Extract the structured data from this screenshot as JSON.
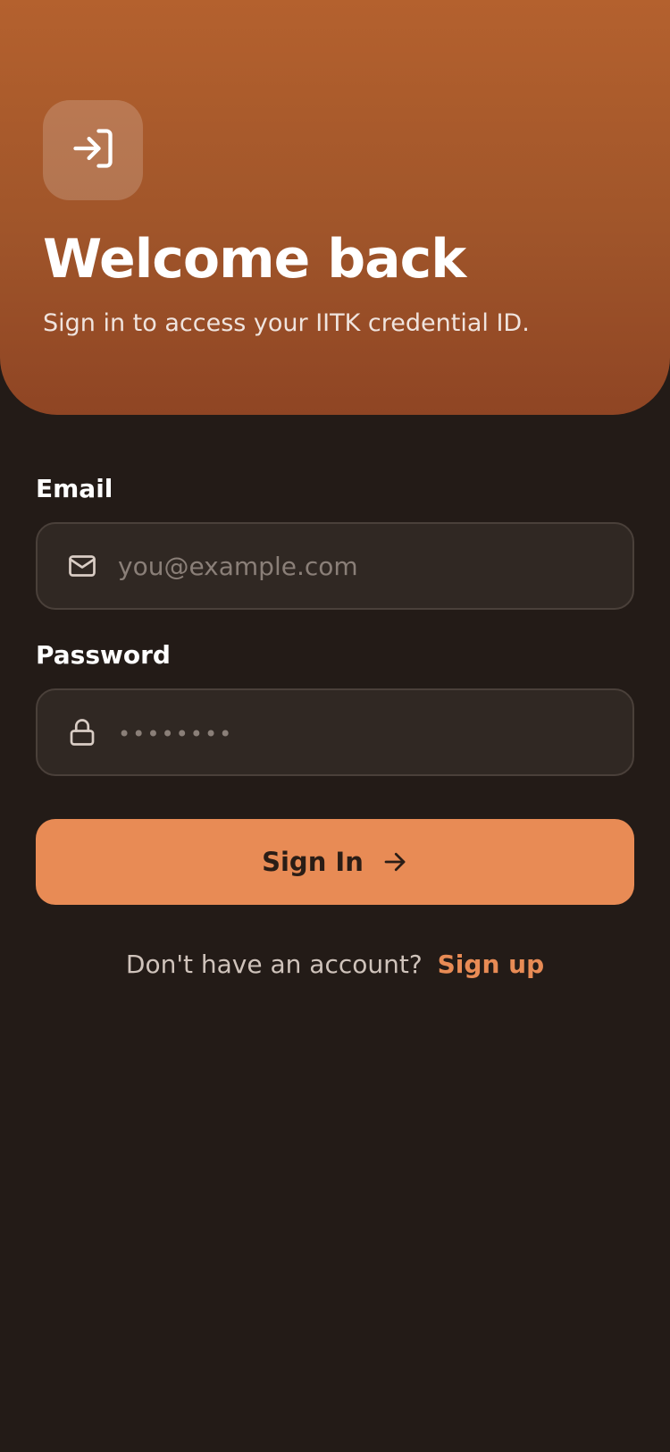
{
  "hero": {
    "icon": "login-icon",
    "title": "Welcome back",
    "subtitle": "Sign in to access your IITK credential ID."
  },
  "email": {
    "label": "Email",
    "icon": "mail-icon",
    "value": "",
    "placeholder": "you@example.com"
  },
  "password": {
    "label": "Password",
    "icon": "lock-icon",
    "value": "",
    "placeholder": "••••••••"
  },
  "signin": {
    "label": "Sign In",
    "icon": "arrow-right-icon"
  },
  "signup": {
    "prompt": "Don't have an account?",
    "link_label": "Sign up"
  },
  "colors": {
    "background": "#231b17",
    "hero_top": "#b4612e",
    "hero_bottom": "#8f4524",
    "accent": "#e88b55",
    "field_bg": "#302823"
  }
}
